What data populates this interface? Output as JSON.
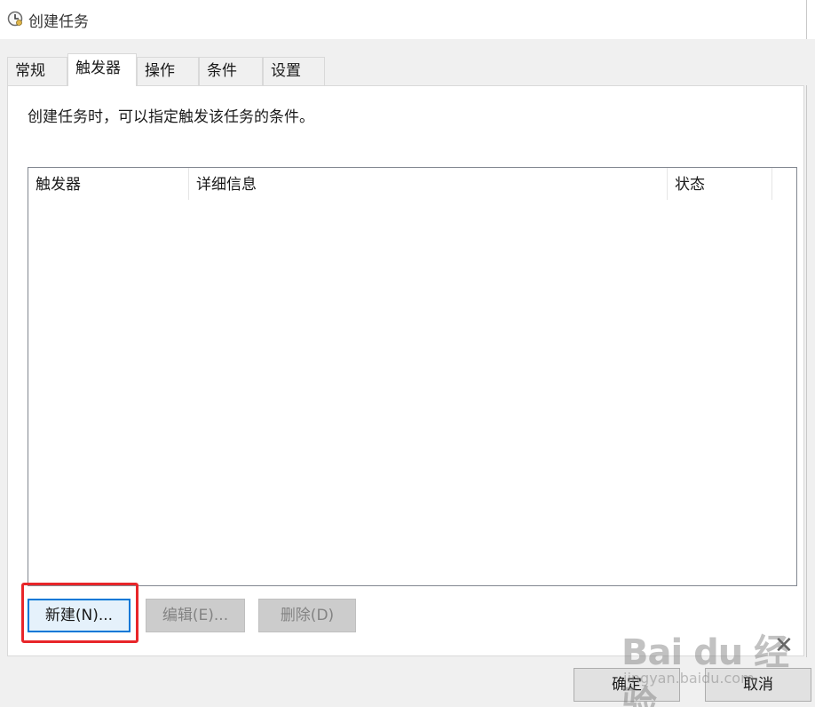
{
  "window": {
    "title": "创建任务"
  },
  "tabs": [
    {
      "label": "常规"
    },
    {
      "label": "触发器"
    },
    {
      "label": "操作"
    },
    {
      "label": "条件"
    },
    {
      "label": "设置"
    }
  ],
  "active_tab": "触发器",
  "triggers_panel": {
    "description": "创建任务时，可以指定触发该任务的条件。",
    "columns": [
      "触发器",
      "详细信息",
      "状态"
    ],
    "rows": []
  },
  "buttons": {
    "new": "新建(N)...",
    "edit": "编辑(E)...",
    "delete": "删除(D)",
    "ok": "确定",
    "cancel": "取消"
  },
  "watermark": {
    "logo": "Bai du 经验",
    "url": "jingyan.baidu.com"
  },
  "colors": {
    "highlight": "#e8262a",
    "focus_border": "#0078d7",
    "dialog_bg": "#f0f0f0"
  }
}
